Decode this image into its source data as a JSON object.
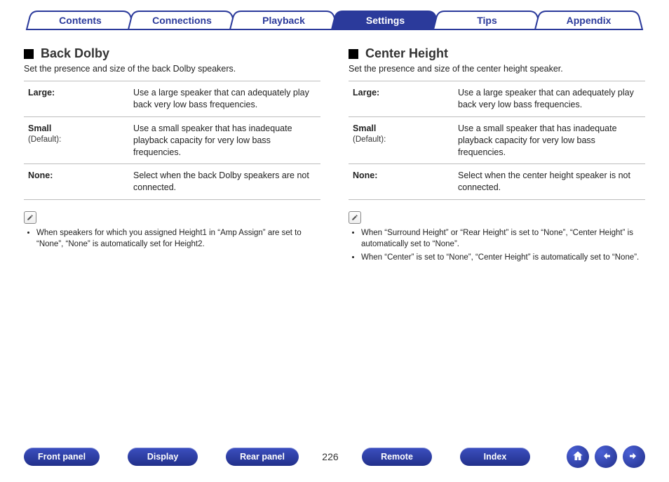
{
  "tabs": {
    "items": [
      {
        "label": "Contents"
      },
      {
        "label": "Connections"
      },
      {
        "label": "Playback"
      },
      {
        "label": "Settings"
      },
      {
        "label": "Tips"
      },
      {
        "label": "Appendix"
      }
    ],
    "active_index": 3
  },
  "left": {
    "title": "Back Dolby",
    "lead": "Set the presence and size of the back Dolby speakers.",
    "rows": [
      {
        "key": "Large:",
        "sub": "",
        "desc": "Use a large speaker that can adequately play back very low bass frequencies."
      },
      {
        "key": "Small",
        "sub": "(Default):",
        "desc": "Use a small speaker that has inadequate playback capacity for very low bass frequencies."
      },
      {
        "key": "None:",
        "sub": "",
        "desc": "Select when the back Dolby speakers are not connected."
      }
    ],
    "notes": [
      "When speakers for which you assigned Height1 in “Amp Assign” are set to “None”, “None” is automatically set for Height2."
    ]
  },
  "right": {
    "title": "Center Height",
    "lead": "Set the presence and size of the center height speaker.",
    "rows": [
      {
        "key": "Large:",
        "sub": "",
        "desc": "Use a large speaker that can adequately play back very low bass frequencies."
      },
      {
        "key": "Small",
        "sub": "(Default):",
        "desc": "Use a small speaker that has inadequate playback capacity for very low bass frequencies."
      },
      {
        "key": "None:",
        "sub": "",
        "desc": "Select when the center height speaker is not connected."
      }
    ],
    "notes": [
      "When “Surround Height” or “Rear Height” is set to “None”, “Center Height” is automatically set to “None”.",
      "When “Center” is set to “None”, “Center Height” is automatically set to “None”."
    ]
  },
  "bottom": {
    "buttons": [
      {
        "label": "Front panel"
      },
      {
        "label": "Display"
      },
      {
        "label": "Rear panel"
      },
      {
        "label": "Remote"
      },
      {
        "label": "Index"
      }
    ],
    "page": "226"
  }
}
